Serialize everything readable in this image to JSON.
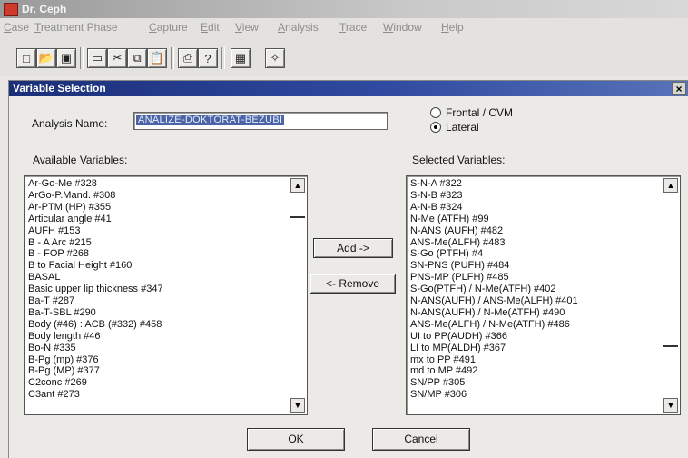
{
  "app": {
    "title": "Dr. Ceph",
    "menu": [
      "Case",
      "Treatment Phase",
      "Capture",
      "Edit",
      "View",
      "Analysis",
      "Trace",
      "Window",
      "Help"
    ]
  },
  "dialog": {
    "title": "Variable Selection",
    "close_label": "×",
    "analysis_name_label": "Analysis Name:",
    "analysis_name_value": "ANALIZE-DOKTORAT-BEZUBI",
    "view_options": [
      {
        "label": "Frontal / CVM",
        "checked": false
      },
      {
        "label": "Lateral",
        "checked": true
      }
    ],
    "available_label": "Available Variables:",
    "selected_label": "Selected Variables:",
    "available_variables": [
      "Ar-Go-Me #328",
      "ArGo-P.Mand. #308",
      "Ar-PTM (HP) #355",
      "Articular angle #41",
      "AUFH #153",
      "B - A Arc #215",
      "B - FOP #268",
      "B to Facial Height #160",
      "BASAL",
      "Basic upper lip thickness #347",
      "Ba-T #287",
      "Ba-T-SBL #290",
      "Body (#46) : ACB (#332) #458",
      "Body length #46",
      "Bo-N #335",
      "B-Pg (mp) #376",
      "B-Pg (MP) #377",
      "C2conc #269",
      "C3ant #273"
    ],
    "selected_variables": [
      "S-N-A #322",
      "S-N-B #323",
      "A-N-B #324",
      "N-Me (ATFH) #99",
      "N-ANS (AUFH) #482",
      "ANS-Me(ALFH) #483",
      "S-Go (PTFH) #4",
      "SN-PNS (PUFH) #484",
      "PNS-MP (PLFH) #485",
      "S-Go(PTFH) / N-Me(ATFH) #402",
      "N-ANS(AUFH) / ANS-Me(ALFH) #401",
      "N-ANS(AUFH) / N-Me(ATFH) #490",
      "ANS-Me(ALFH) / N-Me(ATFH) #486",
      "UI to PP(AUDH) #366",
      "LI to MP(ALDH) #367",
      "mx to PP #491",
      "md to MP #492",
      "SN/PP #305",
      "SN/MP #306"
    ],
    "add_label": "Add ->",
    "remove_label": "<- Remove",
    "ok_label": "OK",
    "cancel_label": "Cancel"
  }
}
